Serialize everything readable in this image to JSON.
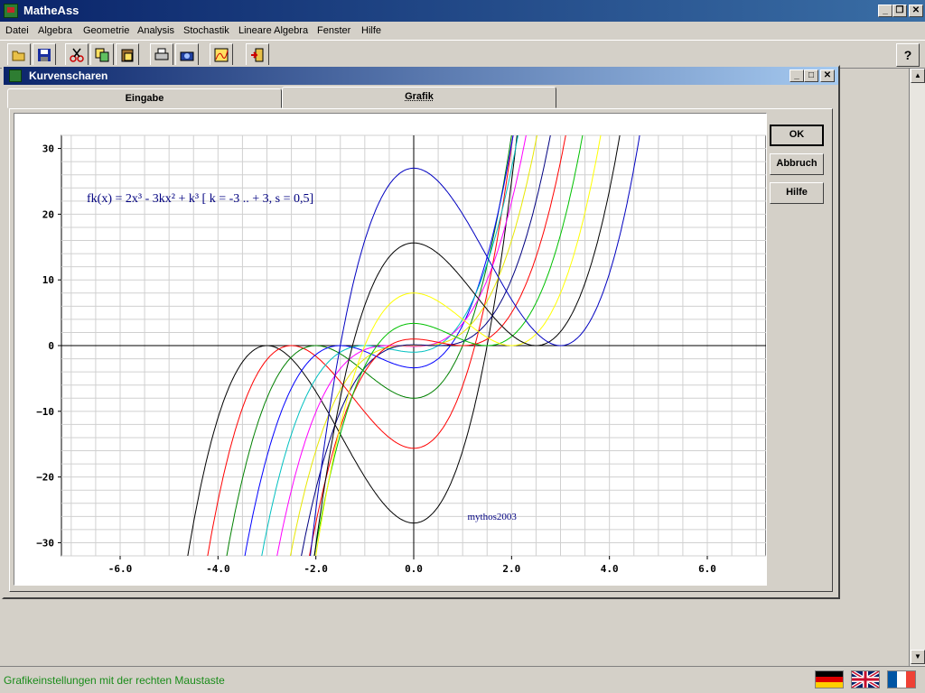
{
  "window": {
    "title": "MatheAss"
  },
  "menu": [
    "Datei",
    "Algebra",
    "Geometrie",
    "Analysis",
    "Stochastik",
    "Lineare Algebra",
    "Fenster",
    "Hilfe"
  ],
  "toolbar": {
    "icons": [
      "open-folder-icon",
      "save-disk-icon",
      "cut-scissors-icon",
      "copy-icon",
      "paste-icon",
      "print-icon",
      "camera-icon",
      "graph-icon",
      "exit-door-icon"
    ],
    "help_label": "?"
  },
  "child": {
    "title": "Kurvenscharen",
    "tabs": [
      {
        "label": "Eingabe",
        "active": false
      },
      {
        "label": "Grafik",
        "active": true
      }
    ],
    "buttons": {
      "ok": "OK",
      "cancel": "Abbruch",
      "help": "Hilfe"
    }
  },
  "chart_data": {
    "type": "line",
    "formula_label": "fk(x) = 2x³ - 3kx² + k³  [ k = -3 .. + 3, s = 0,5]",
    "watermark": "mythos2003",
    "xlim": [
      -7.2,
      7.2
    ],
    "ylim": [
      -32,
      32
    ],
    "x_ticks": [
      -6,
      -4,
      -2,
      0,
      2,
      4,
      6
    ],
    "x_tick_labels": [
      "-6.0",
      "-4.0",
      "-2.0",
      "0.0",
      "2.0",
      "4.0",
      "6.0"
    ],
    "y_ticks": [
      -30,
      -20,
      -10,
      0,
      10,
      20,
      30
    ],
    "y_tick_labels": [
      "−30",
      "−20",
      "−10",
      "0",
      "10",
      "20",
      "30"
    ],
    "grid": true,
    "k_values": [
      -3,
      -2.5,
      -2,
      -1.5,
      -1,
      -0.5,
      0,
      0.5,
      1,
      1.5,
      2,
      2.5,
      3
    ],
    "series_colors": [
      "#000000",
      "#ff0000",
      "#008000",
      "#0000ff",
      "#00c0c0",
      "#ff00ff",
      "#e8e800",
      "#000080",
      "#ff0000",
      "#00c000",
      "#ffff00",
      "#000000",
      "#0000c0"
    ]
  },
  "status": {
    "text": "Grafikeinstellungen mit der rechten Maustaste",
    "color": "#1a8c1a",
    "flags": [
      "flag-germany-icon",
      "flag-uk-icon",
      "flag-france-icon"
    ]
  }
}
